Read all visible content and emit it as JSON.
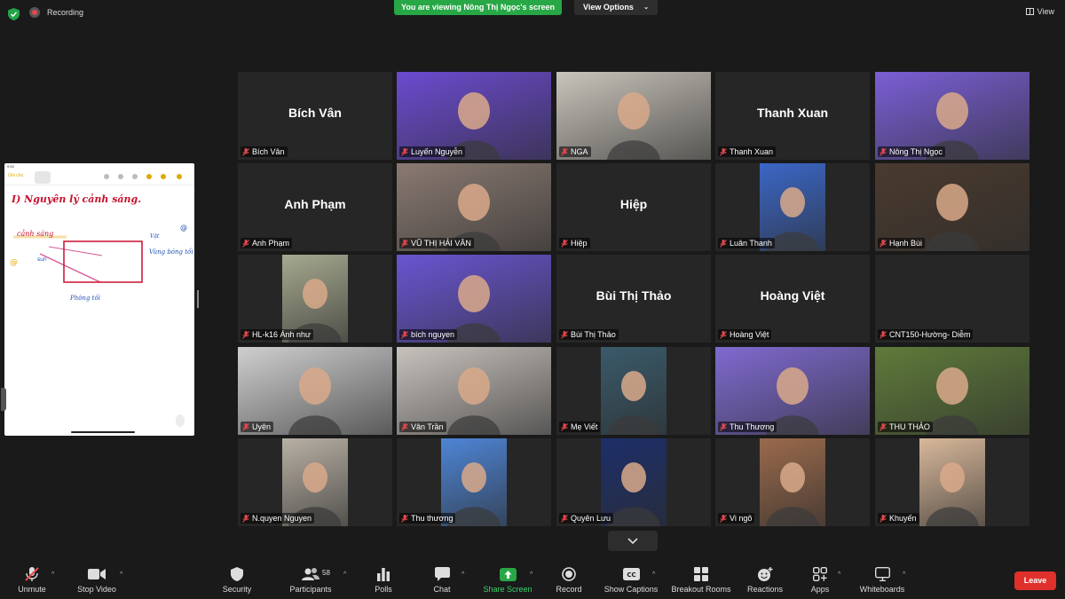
{
  "top": {
    "recording_label": "Recording",
    "viewing_banner": "You are viewing Nông Thị Ngọc's screen",
    "view_options": "View Options",
    "view_label": "View"
  },
  "shared_screen": {
    "status_time": "9:53",
    "back_label": "Ghi chú",
    "note_title": "I) Nguyên lý cảnh sáng.",
    "annotations": [
      "cảnh sáng",
      "Vùng bóng tối",
      "Phòng tối",
      "Vật"
    ]
  },
  "participants": [
    {
      "name": "Bích Vân",
      "video": false
    },
    {
      "name": "Luyến Nguyễn",
      "video": true,
      "bg": "#6b4bd0"
    },
    {
      "name": "NGA",
      "video": true,
      "bg": "#c9c4bb"
    },
    {
      "name": "Thanh Xuan",
      "video": false
    },
    {
      "name": "Nông Thị Ngọc",
      "video": true,
      "bg": "#7a5fd6",
      "active": true
    },
    {
      "name": "Anh Phạm",
      "video": false
    },
    {
      "name": "VŨ THỊ HẢI VÂN",
      "video": true,
      "bg": "#8a7a72"
    },
    {
      "name": "Hiệp",
      "video": false
    },
    {
      "name": "Luân Thanh",
      "video": true,
      "bg": "#3b67c7",
      "narrow": true
    },
    {
      "name": "Hạnh Bùi",
      "video": true,
      "bg": "#4a3a2e"
    },
    {
      "name": "HL-k16 Ánh như",
      "video": true,
      "bg": "#a6a98f",
      "narrow": true
    },
    {
      "name": "bích nguyen",
      "video": true,
      "bg": "#6a55d2"
    },
    {
      "name": "Bùi Thị Thảo",
      "video": false
    },
    {
      "name": "Hoàng Việt",
      "video": false
    },
    {
      "name": "CNT150-Hường- Diễm",
      "video": false,
      "blank": true
    },
    {
      "name": "Uyên",
      "video": true,
      "bg": "#cfcfcf"
    },
    {
      "name": "Vân Trần",
      "video": true,
      "bg": "#c8c2bd"
    },
    {
      "name": "Mẹ Viết",
      "video": true,
      "bg": "#3a5a6a",
      "narrow": true
    },
    {
      "name": "Thu Thương",
      "video": true,
      "bg": "#7f6ad0"
    },
    {
      "name": "THU THẢO",
      "video": true,
      "bg": "#5f7b3a"
    },
    {
      "name": "N.quyen Nguyen",
      "video": true,
      "bg": "#b8b0a4",
      "narrow": true
    },
    {
      "name": "Thu thương",
      "video": true,
      "bg": "#4e85d6",
      "narrow": true
    },
    {
      "name": "Quyên Lưu",
      "video": true,
      "bg": "#1d2f6a",
      "narrow": true
    },
    {
      "name": "Vi ngô",
      "video": true,
      "bg": "#9a6a4c",
      "narrow": true
    },
    {
      "name": "Khuyến",
      "video": true,
      "bg": "#d8b89a",
      "narrow": true
    }
  ],
  "controls": {
    "unmute": "Unmute",
    "stop_video": "Stop Video",
    "security": "Security",
    "participants": "Participants",
    "participants_count": "58",
    "polls": "Polls",
    "chat": "Chat",
    "share_screen": "Share Screen",
    "record": "Record",
    "show_captions": "Show Captions",
    "breakout_rooms": "Breakout Rooms",
    "reactions": "Reactions",
    "apps": "Apps",
    "whiteboards": "Whiteboards",
    "leave": "Leave"
  },
  "colors": {
    "accent_green": "#27a745",
    "leave_red": "#e0302c",
    "active_border": "#d7e25a"
  }
}
